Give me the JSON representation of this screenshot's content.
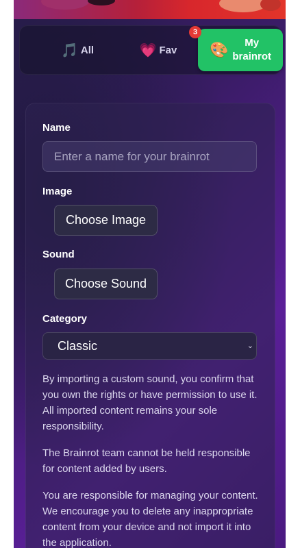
{
  "tabs": {
    "all": {
      "icon": "🎵",
      "label": "All"
    },
    "fav": {
      "icon": "💗",
      "label": "Fav"
    },
    "mine": {
      "icon": "🎨",
      "label_line1": "My",
      "label_line2": "brainrot",
      "badge": "3"
    }
  },
  "form": {
    "name_label": "Name",
    "name_placeholder": "Enter a name for your brainrot",
    "image_label": "Image",
    "image_button": "Choose Image",
    "sound_label": "Sound",
    "sound_button": "Choose Sound",
    "category_label": "Category",
    "category_value": "Classic"
  },
  "disclaimer": [
    "By importing a custom sound, you confirm that you own the rights or have permission to use it. All imported content remains your sole responsibility.",
    "The Brainrot team cannot be held responsible for content added by users.",
    "You are responsible for managing your content. We encourage you to delete any inappropriate content from your device and not import it into the application."
  ],
  "colors": {
    "accent_green": "#22c266",
    "badge_red": "#e53935"
  }
}
